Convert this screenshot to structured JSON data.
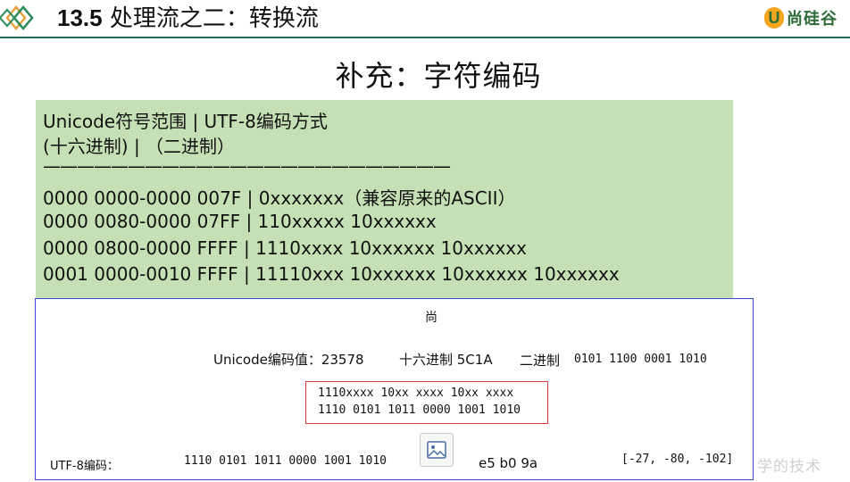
{
  "header": {
    "title_number": "13.5",
    "title_text": "处理流之二：转换流",
    "brand_initial": "U",
    "brand_name": "尚硅谷"
  },
  "subtitle": "补充：字符编码",
  "encoding_table": {
    "header_line1": "Unicode符号范围   | UTF-8编码方式",
    "header_line2": "(十六进制)              |        （二进制）",
    "separator": "————————————————————————",
    "rows": [
      "0000 0000-0000 007F | 0xxxxxxx（兼容原来的ASCII）",
      "0000 0080-0000 07FF | 110xxxxx 10xxxxxx",
      "0000 0800-0000 FFFF | 1110xxxx 10xxxxxx 10xxxxxx",
      "0001 0000-0010 FFFF | 11110xxx 10xxxxxx 10xxxxxx 10xxxxxx"
    ]
  },
  "example": {
    "character": "尚",
    "unicode_label": "Unicode编码值：23578",
    "hex_label": "十六进制 5C1A",
    "binary_label": "二进制",
    "binary_value": "0101 1100 0001 1010",
    "pattern_template": "1110xxxx 10xx xxxx 10xx xxxx",
    "pattern_filled": "1110 0101 1011 0000 1001 1010",
    "utf8_label": "UTF-8编码：",
    "utf8_bits": "1110 0101 1011 0000 1001 1010",
    "utf8_hex": "e5 b0 9a",
    "utf8_signed_bytes": "[-27, -80, -102]",
    "image_icon": "image-icon"
  },
  "watermark": "学的技术",
  "colors": {
    "header_rule": "#1f6b54",
    "green_box": "#c5e0b4",
    "panel_border": "#3c4bd6",
    "pattern_border": "#e23b3b",
    "brand_orange": "#f4a61e",
    "brand_green": "#2d6b37"
  }
}
